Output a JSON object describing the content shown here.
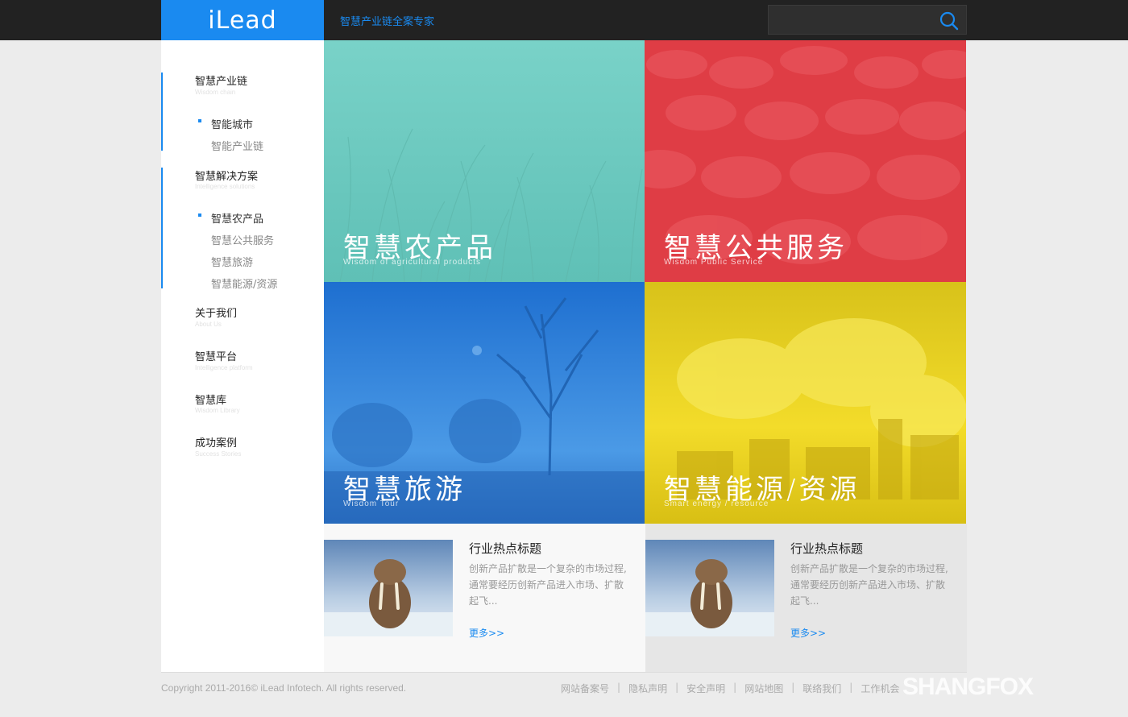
{
  "header": {
    "logo": "iLead",
    "tagline": "智慧产业链全案专家",
    "search_placeholder": ""
  },
  "sidebar": {
    "groups": [
      {
        "title": "智慧产业链",
        "subtitle": "Wisdom chain",
        "items": [
          {
            "label": "智能城市",
            "current": true
          },
          {
            "label": "智能产业链",
            "current": false
          }
        ]
      },
      {
        "title": "智慧解决方案",
        "subtitle": "Intelligence solutions",
        "items": [
          {
            "label": "智慧农产品",
            "current": true
          },
          {
            "label": "智慧公共服务",
            "current": false
          },
          {
            "label": "智慧旅游",
            "current": false
          },
          {
            "label": "智慧能源/资源",
            "current": false
          }
        ]
      },
      {
        "title": "关于我们",
        "subtitle": "About Us"
      },
      {
        "title": "智慧平台",
        "subtitle": "Intelligence platform"
      },
      {
        "title": "智慧库",
        "subtitle": "Wisdom Library"
      },
      {
        "title": "成功案例",
        "subtitle": "Success Stories"
      }
    ]
  },
  "tiles": [
    {
      "title": "智慧农产品",
      "subtitle": "Wisdom of agricultural products",
      "color": "#6ccbc2"
    },
    {
      "title": "智慧公共服务",
      "subtitle": "Wisdom Public Service",
      "color": "#e0424a"
    },
    {
      "title": "智慧旅游",
      "subtitle": "Wisdom Tour",
      "color": "#2a7fd8"
    },
    {
      "title": "智慧能源/资源",
      "subtitle": "Smart energy / resource",
      "color": "#e8cf1a"
    }
  ],
  "news": [
    {
      "title": "行业热点标题",
      "body": "创新产品扩散是一个复杂的市场过程,通常要经历创新产品进入市场、扩散起飞...",
      "more": "更多>>"
    },
    {
      "title": "行业热点标题",
      "body": "创新产品扩散是一个复杂的市场过程,通常要经历创新产品进入市场、扩散起飞...",
      "more": "更多>>"
    }
  ],
  "footer": {
    "copyright": "Copyright 2011-2016© iLead Infotech. All rights reserved.",
    "links": [
      "网站备案号",
      "隐私声明",
      "安全声明",
      "网站地图",
      "联络我们",
      "工作机会"
    ],
    "watermark": "SHANGFOX"
  },
  "colors": {
    "accent": "#1a8af0",
    "topbar": "#222222"
  }
}
